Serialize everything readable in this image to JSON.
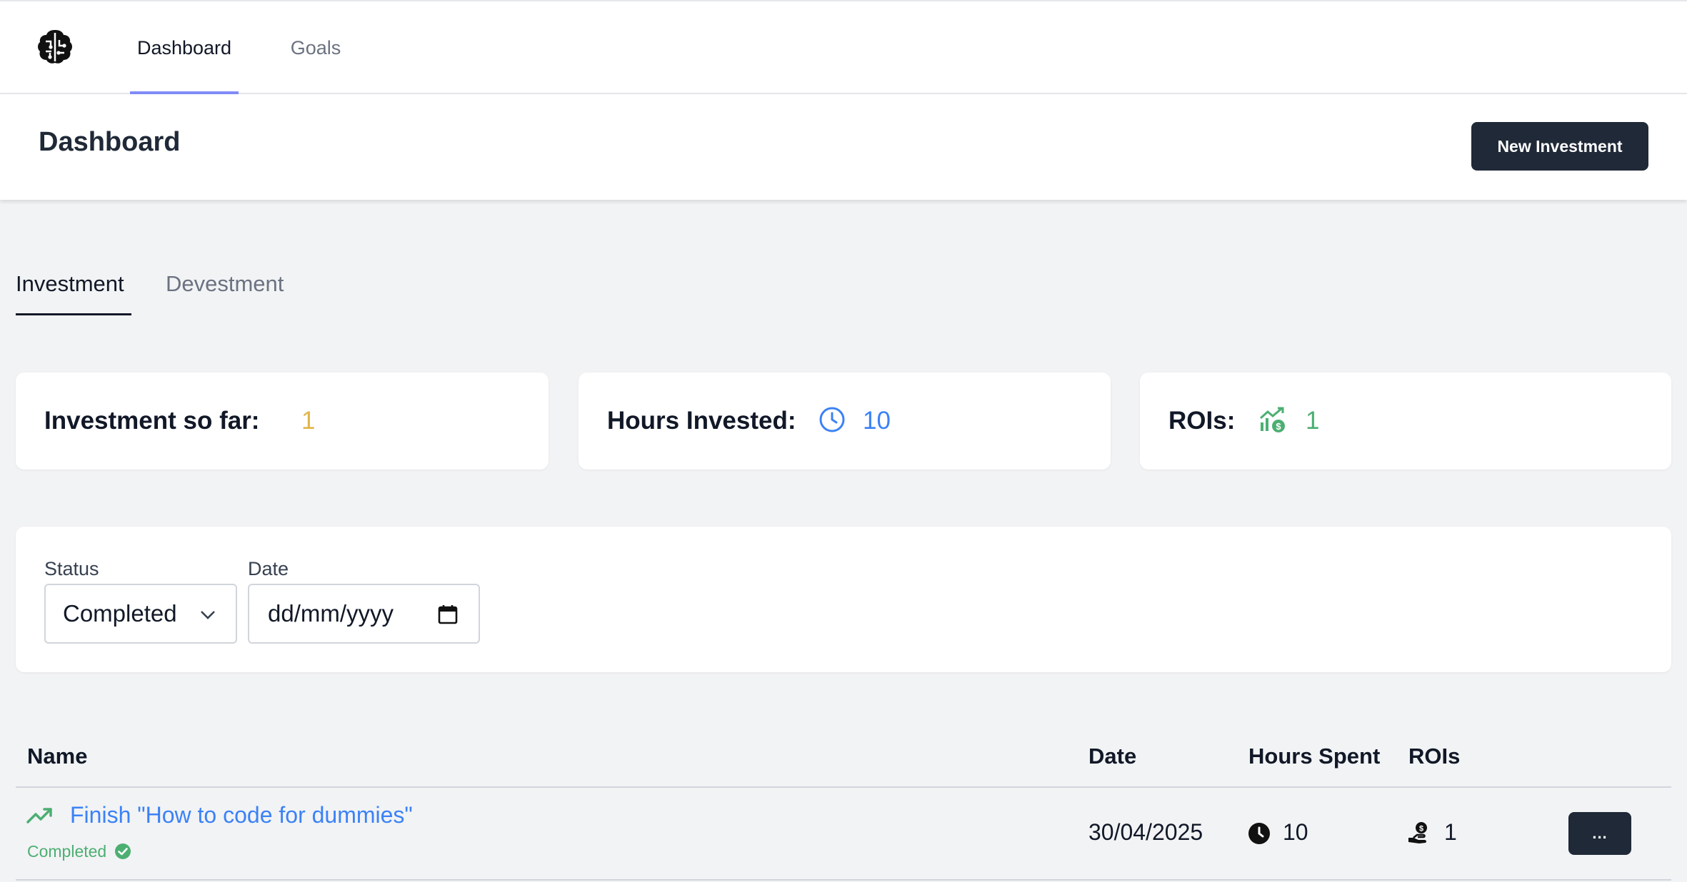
{
  "nav": {
    "logo_icon": "brain-circuit-icon",
    "tabs": [
      {
        "label": "Dashboard",
        "active": true
      },
      {
        "label": "Goals",
        "active": false
      }
    ]
  },
  "header": {
    "title": "Dashboard",
    "new_button_label": "New Investment"
  },
  "subtabs": [
    {
      "label": "Investment",
      "active": true
    },
    {
      "label": "Devestment",
      "active": false
    }
  ],
  "stats": {
    "investment": {
      "label": "Investment so far:",
      "value": "1",
      "color": "#e0b54a"
    },
    "hours": {
      "label": "Hours Invested:",
      "value": "10",
      "icon": "clock-icon",
      "color": "#3b82f6"
    },
    "rois": {
      "label": "ROIs:",
      "value": "1",
      "icon": "money-growth-icon",
      "color": "#4caf72"
    }
  },
  "filters": {
    "status_label": "Status",
    "status_value": "Completed",
    "date_label": "Date",
    "date_placeholder": "dd/mm/yyyy"
  },
  "table": {
    "headers": [
      "Name",
      "Date",
      "Hours Spent",
      "ROIs"
    ],
    "rows": [
      {
        "name": "Finish \"How to code for dummies\"",
        "status": "Completed",
        "date": "30/04/2025",
        "hours": "10",
        "rois": "1",
        "action_label": "..."
      }
    ]
  },
  "colors": {
    "accent": "#818cf8",
    "dark_button": "#1f2937",
    "link_blue": "#3b82f6",
    "success_green": "#4caf72"
  }
}
